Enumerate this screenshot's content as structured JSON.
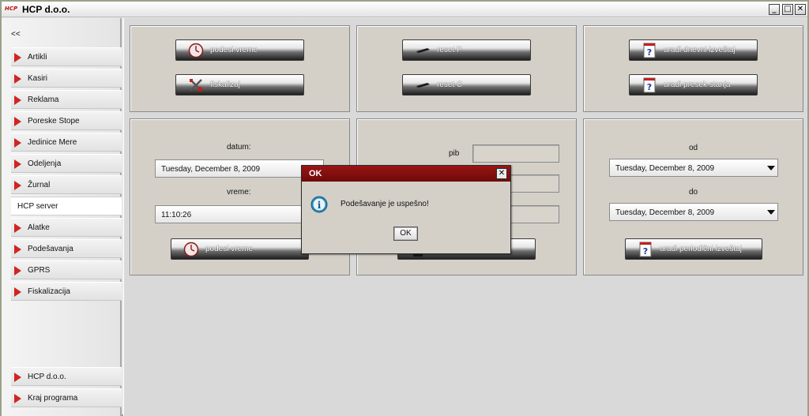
{
  "window": {
    "title": "HCP d.o.o.",
    "logo_text": "HCP",
    "controls": [
      "_",
      "□",
      "✕"
    ]
  },
  "sidebar": {
    "collapse": "<<",
    "items": [
      {
        "label": "Artikli"
      },
      {
        "label": "Kasiri"
      },
      {
        "label": "Reklama"
      },
      {
        "label": "Poreske Stope"
      },
      {
        "label": "Jedinice Mere"
      },
      {
        "label": "Odeljenja"
      },
      {
        "label": "Žurnal"
      },
      {
        "label": "HCP server"
      },
      {
        "label": "Alatke"
      },
      {
        "label": "Podešavanja"
      },
      {
        "label": "GPRS"
      },
      {
        "label": "Fiskalizacija"
      }
    ],
    "active": "HCP server",
    "footer": [
      {
        "label": "HCP d.o.o."
      },
      {
        "label": "Kraj programa"
      }
    ]
  },
  "panels": {
    "time": {
      "set_time_button": "podesi vreme",
      "fiscalize_button": "fiskalizuj"
    },
    "reset": {
      "reset_p_button": "reset P",
      "reset_c_button": "reset C"
    },
    "reports": {
      "daily_button": "uradi dnevni izveštaj",
      "cutoff_button": "uradi presek stanja"
    },
    "datetime": {
      "date_label": "datum:",
      "date_value": "Tuesday, December 8, 2009",
      "time_label": "vreme:",
      "time_value": "11:10:26",
      "set_time_button": "podesi vreme"
    },
    "pib": {
      "pib_label": "pib"
    },
    "periodic": {
      "from_label": "od",
      "from_value": "Tuesday, December 8, 2009",
      "to_label": "do",
      "to_value": "Tuesday, December 8, 2009",
      "periodic_button": "uradi periodični izveštaj"
    }
  },
  "dialog": {
    "title": "OK",
    "message": "Podešavanje je uspešno!",
    "ok_button": "OK",
    "close": "✕"
  },
  "colors": {
    "accent_red": "#d02424",
    "dialog_title": "#8a1010",
    "panel_bg": "#d4d0c8"
  }
}
